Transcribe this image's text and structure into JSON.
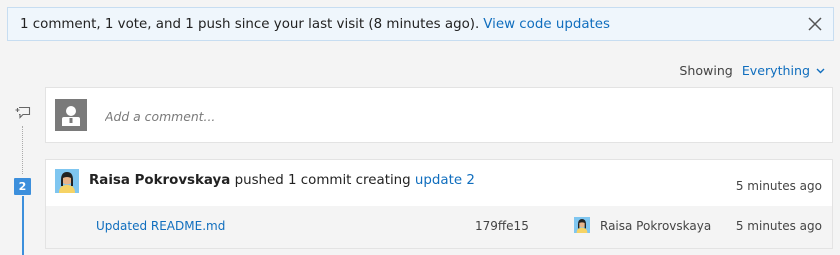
{
  "banner": {
    "message": "1 comment, 1 vote, and 1 push since your last visit (8 minutes ago).",
    "link_label": "View code updates",
    "close_icon": "close-icon"
  },
  "filter": {
    "label": "Showing",
    "value": "Everything"
  },
  "comment_box": {
    "placeholder": "Add a comment..."
  },
  "timeline": {
    "update_number": "2"
  },
  "push_event": {
    "author": "Raisa Pokrovskaya",
    "action": " pushed 1 commit creating ",
    "link_label": "update 2",
    "time": "5 minutes ago",
    "commit": {
      "message": "Updated README.md",
      "hash": "179ffe15",
      "author": "Raisa Pokrovskaya",
      "time": "5 minutes ago"
    }
  },
  "colors": {
    "accent": "#106ebe",
    "badge": "#3c8fdc",
    "banner_bg": "#eff6fc"
  }
}
